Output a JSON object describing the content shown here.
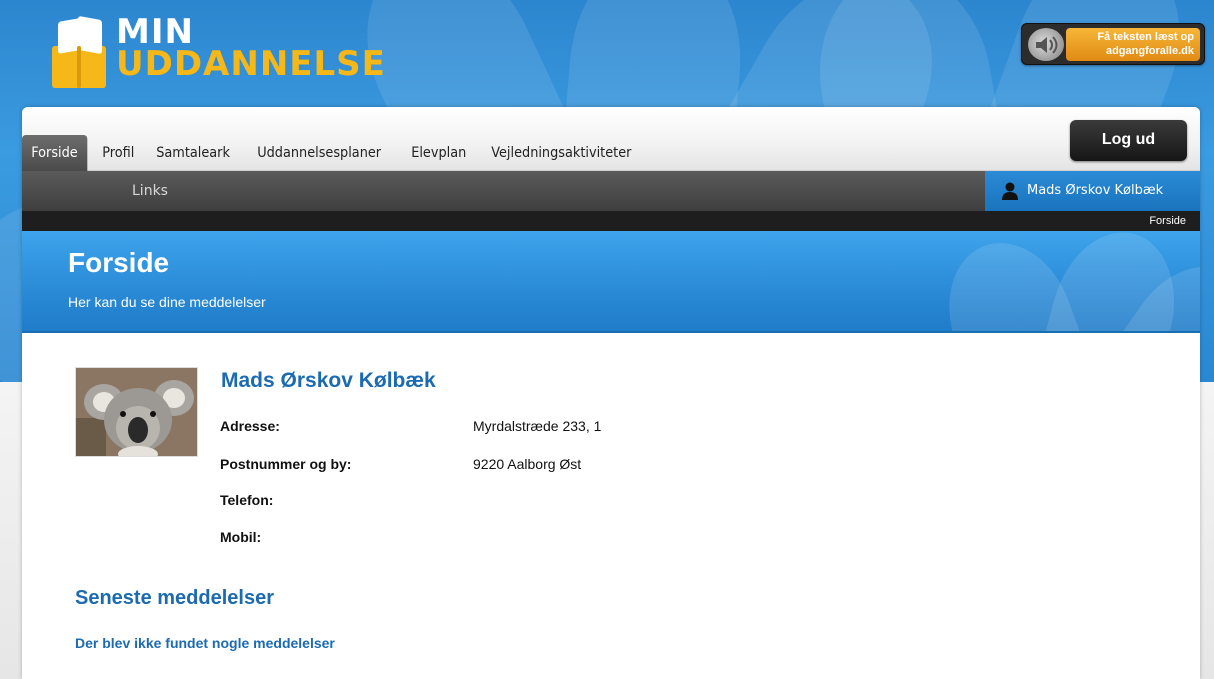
{
  "logo": {
    "line1": "MIN",
    "line2": "UDDANNELSE"
  },
  "read_aloud": {
    "line1": "Få teksten læst op",
    "line2": "adgangforalle.dk"
  },
  "nav": {
    "tabs": [
      {
        "label": "Forside",
        "active": true
      },
      {
        "label": "Profil",
        "active": false
      },
      {
        "label": "Samtaleark",
        "active": false
      },
      {
        "label": "Uddannelsesplaner",
        "active": false
      },
      {
        "label": "Elevplan",
        "active": false
      },
      {
        "label": "Vejledningsaktiviteter",
        "active": false
      }
    ],
    "logout_label": "Log ud",
    "sub_links": "Links",
    "user_name": "Mads Ørskov Kølbæk",
    "breadcrumb": "Forside"
  },
  "page": {
    "title": "Forside",
    "subtitle": "Her kan du se dine meddelelser"
  },
  "profile": {
    "name": "Mads Ørskov Kølbæk",
    "fields": [
      {
        "label": "Adresse:",
        "value": "Myrdalstræde 233, 1"
      },
      {
        "label": "Postnummer og by:",
        "value": "9220 Aalborg Øst"
      },
      {
        "label": "Telefon:",
        "value": ""
      },
      {
        "label": "Mobil:",
        "value": ""
      }
    ]
  },
  "messages": {
    "title": "Seneste meddelelser",
    "empty_text": "Der blev ikke fundet nogle meddelelser"
  },
  "colors": {
    "brand_blue": "#2a88d2",
    "brand_yellow": "#f6b718",
    "heading_blue": "#1c6ab0"
  }
}
